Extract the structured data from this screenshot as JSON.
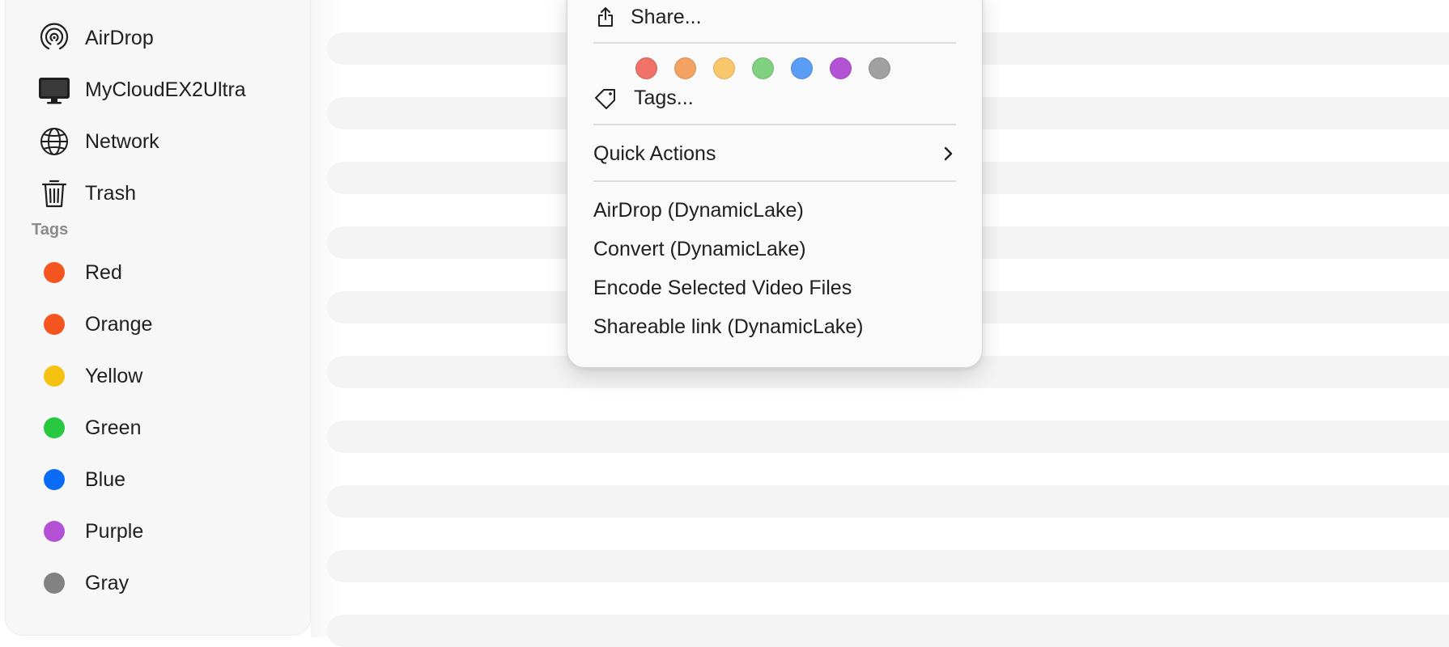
{
  "sidebar": {
    "locations": [
      {
        "label": "AirDrop",
        "icon": "airdrop-icon"
      },
      {
        "label": "MyCloudEX2Ultra",
        "icon": "display-icon"
      },
      {
        "label": "Network",
        "icon": "globe-icon"
      },
      {
        "label": "Trash",
        "icon": "trash-icon"
      }
    ],
    "tags_header": "Tags",
    "tags": [
      {
        "label": "Red",
        "color": "#f5561f"
      },
      {
        "label": "Orange",
        "color": "#f5561f"
      },
      {
        "label": "Yellow",
        "color": "#f5c211"
      },
      {
        "label": "Green",
        "color": "#28c840"
      },
      {
        "label": "Blue",
        "color": "#0a6cf5"
      },
      {
        "label": "Purple",
        "color": "#b452d6"
      },
      {
        "label": "Gray",
        "color": "#828282"
      }
    ]
  },
  "context_menu": {
    "share_label": "Share...",
    "share_icon": "share-icon",
    "tag_colors": [
      "#f07167",
      "#f4a261",
      "#f9c66b",
      "#7fd07f",
      "#5b9cf5",
      "#b452d6",
      "#a0a0a0"
    ],
    "tags_label": "Tags...",
    "tags_icon": "tag-icon",
    "quick_actions_label": "Quick Actions",
    "quick_actions_icon": "chevron-right-icon",
    "actions": [
      {
        "label": "AirDrop (DynamicLake)"
      },
      {
        "label": "Convert (DynamicLake)"
      },
      {
        "label": "Encode Selected Video Files"
      },
      {
        "label": "Shareable link (DynamicLake)"
      }
    ]
  }
}
